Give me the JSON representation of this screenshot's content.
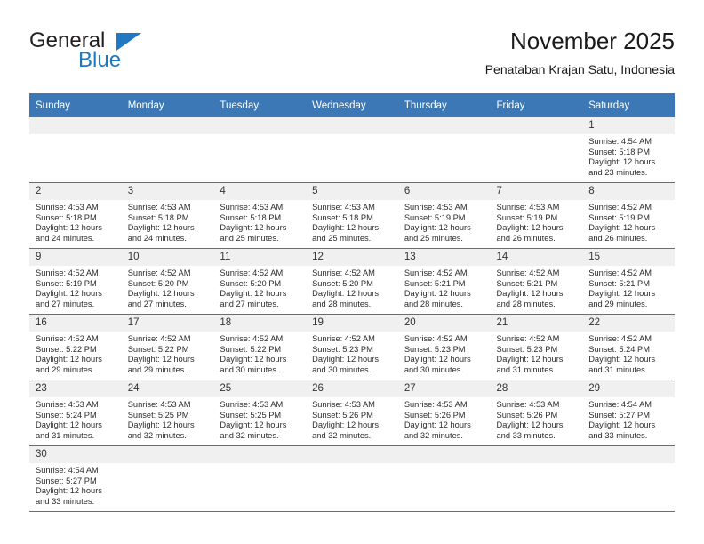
{
  "brand": {
    "name_top": "General",
    "name_bottom": "Blue",
    "accent_color": "#1f78c1"
  },
  "header": {
    "title": "November 2025",
    "subtitle": "Penataban Krajan Satu, Indonesia"
  },
  "calendar": {
    "header_bg": "#3b78b5",
    "daynum_bg": "#f0f0f0",
    "weekday_names": [
      "Sunday",
      "Monday",
      "Tuesday",
      "Wednesday",
      "Thursday",
      "Friday",
      "Saturday"
    ],
    "weeks": [
      [
        {
          "day": "",
          "lines": []
        },
        {
          "day": "",
          "lines": []
        },
        {
          "day": "",
          "lines": []
        },
        {
          "day": "",
          "lines": []
        },
        {
          "day": "",
          "lines": []
        },
        {
          "day": "",
          "lines": []
        },
        {
          "day": "1",
          "lines": [
            "Sunrise: 4:54 AM",
            "Sunset: 5:18 PM",
            "Daylight: 12 hours",
            "and 23 minutes."
          ]
        }
      ],
      [
        {
          "day": "2",
          "lines": [
            "Sunrise: 4:53 AM",
            "Sunset: 5:18 PM",
            "Daylight: 12 hours",
            "and 24 minutes."
          ]
        },
        {
          "day": "3",
          "lines": [
            "Sunrise: 4:53 AM",
            "Sunset: 5:18 PM",
            "Daylight: 12 hours",
            "and 24 minutes."
          ]
        },
        {
          "day": "4",
          "lines": [
            "Sunrise: 4:53 AM",
            "Sunset: 5:18 PM",
            "Daylight: 12 hours",
            "and 25 minutes."
          ]
        },
        {
          "day": "5",
          "lines": [
            "Sunrise: 4:53 AM",
            "Sunset: 5:18 PM",
            "Daylight: 12 hours",
            "and 25 minutes."
          ]
        },
        {
          "day": "6",
          "lines": [
            "Sunrise: 4:53 AM",
            "Sunset: 5:19 PM",
            "Daylight: 12 hours",
            "and 25 minutes."
          ]
        },
        {
          "day": "7",
          "lines": [
            "Sunrise: 4:53 AM",
            "Sunset: 5:19 PM",
            "Daylight: 12 hours",
            "and 26 minutes."
          ]
        },
        {
          "day": "8",
          "lines": [
            "Sunrise: 4:52 AM",
            "Sunset: 5:19 PM",
            "Daylight: 12 hours",
            "and 26 minutes."
          ]
        }
      ],
      [
        {
          "day": "9",
          "lines": [
            "Sunrise: 4:52 AM",
            "Sunset: 5:19 PM",
            "Daylight: 12 hours",
            "and 27 minutes."
          ]
        },
        {
          "day": "10",
          "lines": [
            "Sunrise: 4:52 AM",
            "Sunset: 5:20 PM",
            "Daylight: 12 hours",
            "and 27 minutes."
          ]
        },
        {
          "day": "11",
          "lines": [
            "Sunrise: 4:52 AM",
            "Sunset: 5:20 PM",
            "Daylight: 12 hours",
            "and 27 minutes."
          ]
        },
        {
          "day": "12",
          "lines": [
            "Sunrise: 4:52 AM",
            "Sunset: 5:20 PM",
            "Daylight: 12 hours",
            "and 28 minutes."
          ]
        },
        {
          "day": "13",
          "lines": [
            "Sunrise: 4:52 AM",
            "Sunset: 5:21 PM",
            "Daylight: 12 hours",
            "and 28 minutes."
          ]
        },
        {
          "day": "14",
          "lines": [
            "Sunrise: 4:52 AM",
            "Sunset: 5:21 PM",
            "Daylight: 12 hours",
            "and 28 minutes."
          ]
        },
        {
          "day": "15",
          "lines": [
            "Sunrise: 4:52 AM",
            "Sunset: 5:21 PM",
            "Daylight: 12 hours",
            "and 29 minutes."
          ]
        }
      ],
      [
        {
          "day": "16",
          "lines": [
            "Sunrise: 4:52 AM",
            "Sunset: 5:22 PM",
            "Daylight: 12 hours",
            "and 29 minutes."
          ]
        },
        {
          "day": "17",
          "lines": [
            "Sunrise: 4:52 AM",
            "Sunset: 5:22 PM",
            "Daylight: 12 hours",
            "and 29 minutes."
          ]
        },
        {
          "day": "18",
          "lines": [
            "Sunrise: 4:52 AM",
            "Sunset: 5:22 PM",
            "Daylight: 12 hours",
            "and 30 minutes."
          ]
        },
        {
          "day": "19",
          "lines": [
            "Sunrise: 4:52 AM",
            "Sunset: 5:23 PM",
            "Daylight: 12 hours",
            "and 30 minutes."
          ]
        },
        {
          "day": "20",
          "lines": [
            "Sunrise: 4:52 AM",
            "Sunset: 5:23 PM",
            "Daylight: 12 hours",
            "and 30 minutes."
          ]
        },
        {
          "day": "21",
          "lines": [
            "Sunrise: 4:52 AM",
            "Sunset: 5:23 PM",
            "Daylight: 12 hours",
            "and 31 minutes."
          ]
        },
        {
          "day": "22",
          "lines": [
            "Sunrise: 4:52 AM",
            "Sunset: 5:24 PM",
            "Daylight: 12 hours",
            "and 31 minutes."
          ]
        }
      ],
      [
        {
          "day": "23",
          "lines": [
            "Sunrise: 4:53 AM",
            "Sunset: 5:24 PM",
            "Daylight: 12 hours",
            "and 31 minutes."
          ]
        },
        {
          "day": "24",
          "lines": [
            "Sunrise: 4:53 AM",
            "Sunset: 5:25 PM",
            "Daylight: 12 hours",
            "and 32 minutes."
          ]
        },
        {
          "day": "25",
          "lines": [
            "Sunrise: 4:53 AM",
            "Sunset: 5:25 PM",
            "Daylight: 12 hours",
            "and 32 minutes."
          ]
        },
        {
          "day": "26",
          "lines": [
            "Sunrise: 4:53 AM",
            "Sunset: 5:26 PM",
            "Daylight: 12 hours",
            "and 32 minutes."
          ]
        },
        {
          "day": "27",
          "lines": [
            "Sunrise: 4:53 AM",
            "Sunset: 5:26 PM",
            "Daylight: 12 hours",
            "and 32 minutes."
          ]
        },
        {
          "day": "28",
          "lines": [
            "Sunrise: 4:53 AM",
            "Sunset: 5:26 PM",
            "Daylight: 12 hours",
            "and 33 minutes."
          ]
        },
        {
          "day": "29",
          "lines": [
            "Sunrise: 4:54 AM",
            "Sunset: 5:27 PM",
            "Daylight: 12 hours",
            "and 33 minutes."
          ]
        }
      ],
      [
        {
          "day": "30",
          "lines": [
            "Sunrise: 4:54 AM",
            "Sunset: 5:27 PM",
            "Daylight: 12 hours",
            "and 33 minutes."
          ]
        },
        {
          "day": "",
          "lines": []
        },
        {
          "day": "",
          "lines": []
        },
        {
          "day": "",
          "lines": []
        },
        {
          "day": "",
          "lines": []
        },
        {
          "day": "",
          "lines": []
        },
        {
          "day": "",
          "lines": []
        }
      ]
    ]
  }
}
